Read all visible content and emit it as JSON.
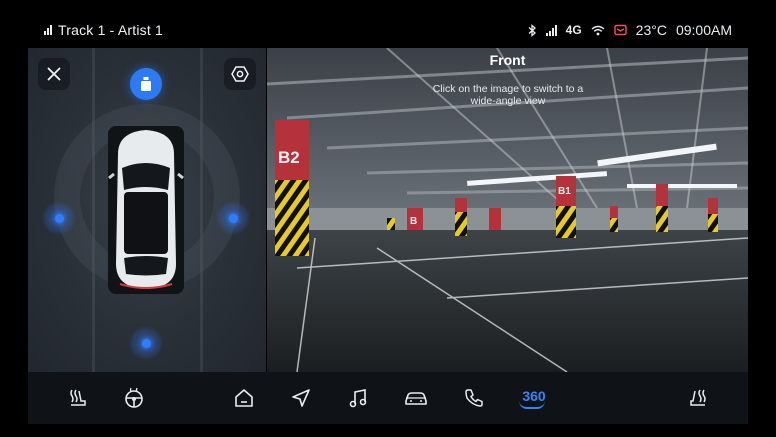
{
  "status_bar": {
    "track": "Track 1 - Artist 1",
    "network": "4G",
    "temperature": "23°C",
    "time": "09:00AM"
  },
  "camera": {
    "title": "Front",
    "hint": "Click on the image to switch to a wide-angle view",
    "pillar_labels": [
      "B2",
      "B1",
      "B",
      "B1",
      "B"
    ]
  },
  "dock": {
    "items": [
      "seat-heat-left-icon",
      "steering-heat-icon",
      "home-icon",
      "navigation-icon",
      "music-icon",
      "car-icon",
      "phone-icon",
      "360-view",
      "seat-heat-right-icon"
    ],
    "active_label": "360",
    "accent_color": "#2f86ff"
  },
  "colors": {
    "accent": "#2d7af5",
    "background": "#000000"
  }
}
